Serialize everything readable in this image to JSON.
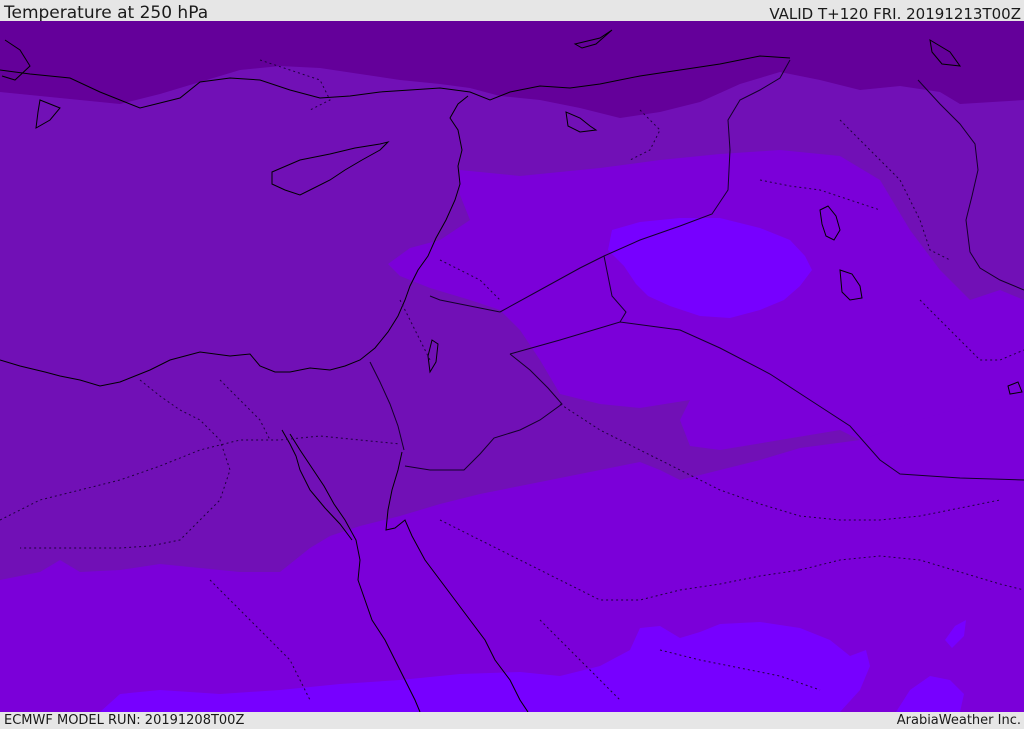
{
  "header": {
    "title": "Temperature at 250 hPa",
    "valid": "VALID T+120 FRI. 20191213T00Z"
  },
  "footer": {
    "model_run": "ECMWF MODEL RUN: 20191208T00Z",
    "credit": "ArabiaWeather Inc."
  },
  "map": {
    "field": "temperature",
    "level": "250 hPa",
    "colors": {
      "coldest_band": "#64009a",
      "cold_band": "#7110b6",
      "mid_band": "#7b00d9",
      "warm_band": "#7d00f5",
      "warmest_band": "#7700ff",
      "coastline": "#000000",
      "border": "#1a0033"
    }
  }
}
